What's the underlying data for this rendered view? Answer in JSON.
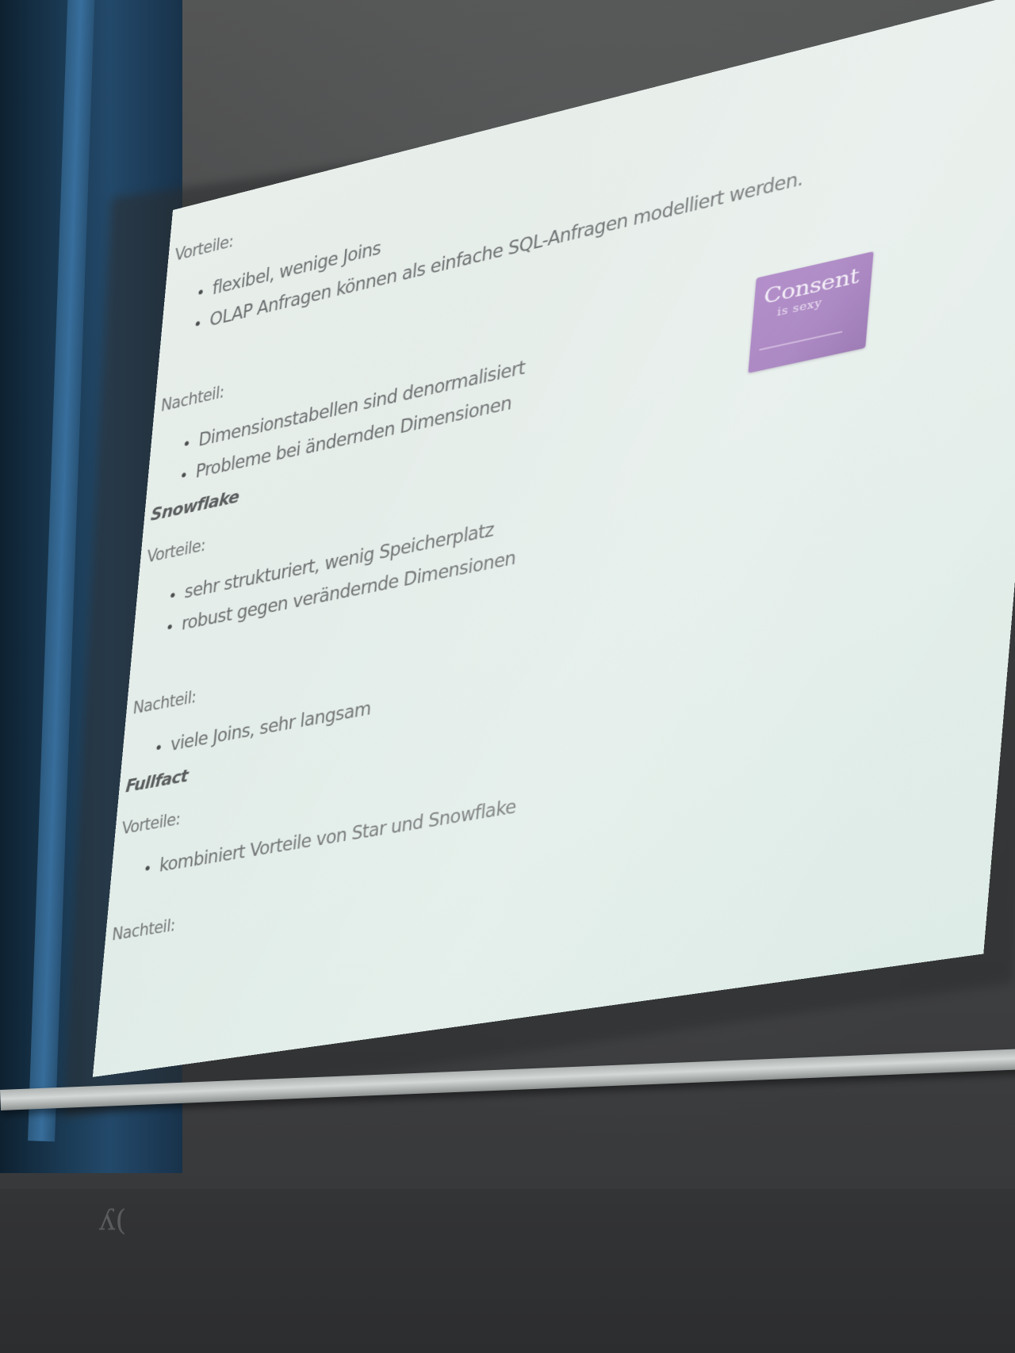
{
  "slide": {
    "star_pros_label": "Vorteile:",
    "star_pros": [
      "flexibel, wenige Joins",
      "OLAP Anfragen können als einfache SQL-Anfragen modelliert werden."
    ],
    "star_cons_label": "Nachteil:",
    "star_cons": [
      "Dimensionstabellen sind denormalisiert",
      "Probleme bei ändernden Dimensionen"
    ],
    "snowflake_heading": "Snowflake",
    "snowflake_pros_label": "Vorteile:",
    "snowflake_pros": [
      "sehr strukturiert, wenig Speicherplatz",
      "robust gegen verändernde Dimensionen"
    ],
    "snowflake_cons_label": "Nachteil:",
    "snowflake_cons": [
      "viele Joins, sehr langsam"
    ],
    "fullfact_heading": "Fullfact",
    "fullfact_pros_label": "Vorteile:",
    "fullfact_pros": [
      "kombiniert Vorteile von Star und Snowflake"
    ],
    "fullfact_cons_label": "Nachteil:"
  },
  "sticker": {
    "title": "Consent",
    "subtitle": "is sexy",
    "color": "#a77cc2"
  }
}
